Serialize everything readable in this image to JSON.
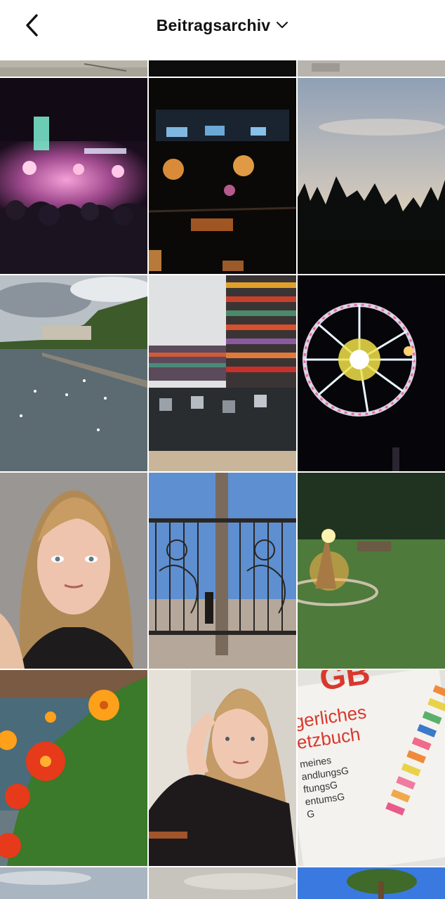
{
  "header": {
    "title": "Beitragsarchiv",
    "back_icon": "chevron-left-icon",
    "dropdown_icon": "chevron-down-icon"
  },
  "colors": {
    "background": "#ffffff",
    "title_text": "#111111"
  },
  "book_cover": {
    "letters": "GB",
    "lines": [
      "gerliches",
      "etzbuch"
    ],
    "small_lines": [
      "meines",
      "andlungsG",
      "ftungsG",
      "entumsG",
      "G"
    ]
  },
  "grid": {
    "rows": [
      [
        "Sandiger Boden",
        "Dunkles Bild",
        "Sandiger Boden"
      ],
      [
        "Konzert mit Publikum",
        "Nachtlichter im Gebäude",
        "Baumsilhouetten bei Sonnenuntergang"
      ],
      [
        "See mit Schwänen",
        "Gestreiftes Gebäude",
        "Riesenrad bei Nacht"
      ],
      [
        "Selfie Porträt",
        "Skulpturen-Tor",
        "Lagerfeuer im Garten"
      ],
      [
        "Rote und gelbe Blumen",
        "Porträt",
        "Gesetzbuch mit Markern"
      ],
      [
        "Himmel",
        "Himmel",
        "Baum"
      ]
    ]
  }
}
